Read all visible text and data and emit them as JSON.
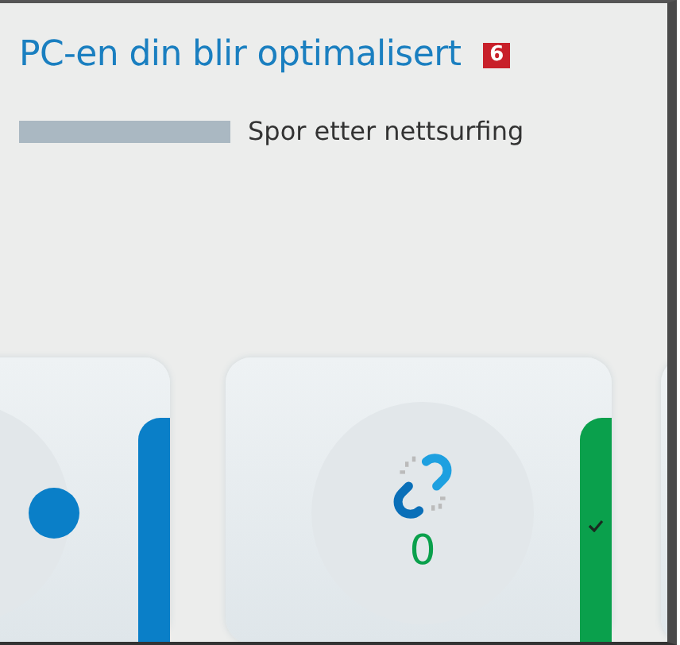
{
  "header": {
    "title": "PC-en din blir optimalisert",
    "callout": "6"
  },
  "progress": {
    "level": 1,
    "status": "Spor etter nettsurfing"
  },
  "cards": [
    {
      "color": "#0a7fc8",
      "checked": false
    },
    {
      "color": "#0aa04c",
      "checked": true,
      "count": "0"
    }
  ]
}
